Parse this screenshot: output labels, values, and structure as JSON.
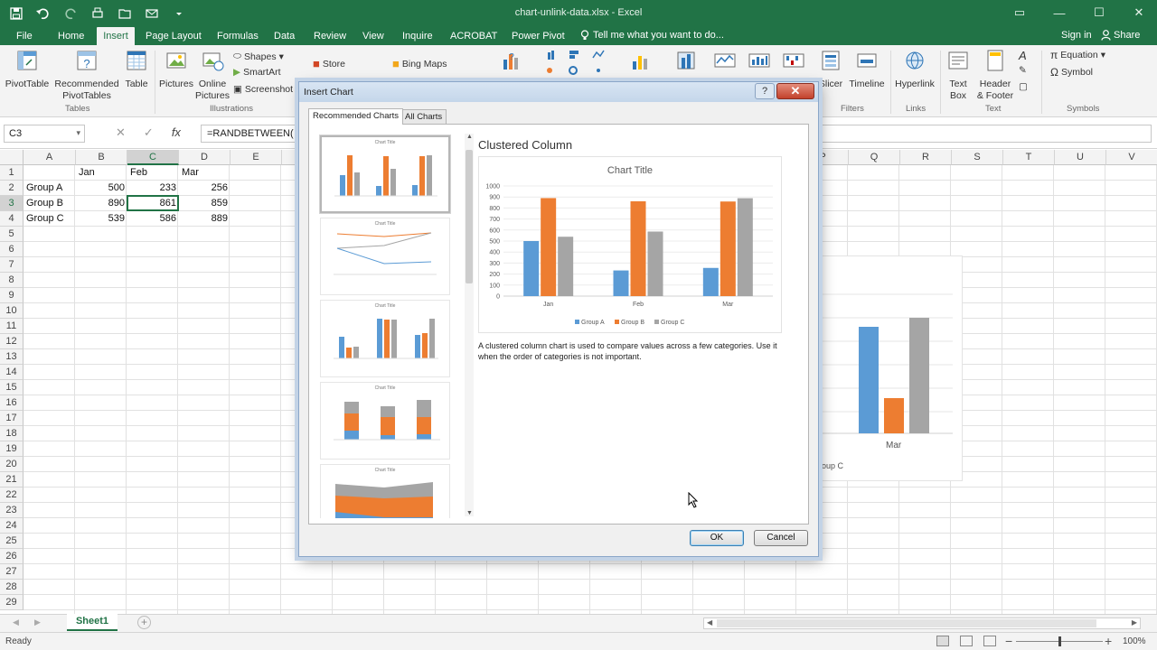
{
  "titlebar": {
    "title": "chart-unlink-data.xlsx - Excel",
    "qat_icons": [
      "save-icon",
      "undo-icon",
      "redo-icon",
      "quick-print-icon",
      "open-icon",
      "email-icon",
      "customize-icon"
    ]
  },
  "tabs": [
    {
      "label": "File",
      "active": false
    },
    {
      "label": "Home",
      "active": false
    },
    {
      "label": "Insert",
      "active": true
    },
    {
      "label": "Page Layout",
      "active": false
    },
    {
      "label": "Formulas",
      "active": false
    },
    {
      "label": "Data",
      "active": false
    },
    {
      "label": "Review",
      "active": false
    },
    {
      "label": "View",
      "active": false
    },
    {
      "label": "Inquire",
      "active": false
    },
    {
      "label": "ACROBAT",
      "active": false
    },
    {
      "label": "Power Pivot",
      "active": false
    }
  ],
  "tellme": "Tell me what you want to do...",
  "signin": "Sign in",
  "share": "Share",
  "ribbon": {
    "pivottable": "PivotTable",
    "recommended1": "Recommended",
    "recommended2": "PivotTables",
    "table": "Table",
    "pictures": "Pictures",
    "online1": "Online",
    "online2": "Pictures",
    "shapes": "Shapes",
    "smartart": "SmartArt",
    "screenshot": "Screenshot",
    "store": "Store",
    "bingmaps": "Bing Maps",
    "slicer": "Slicer",
    "timeline": "Timeline",
    "hyperlink": "Hyperlink",
    "textbox1": "Text",
    "textbox2": "Box",
    "header1": "Header",
    "header2": "& Footer",
    "equation": "Equation",
    "symbol": "Symbol",
    "groups": {
      "tables": "Tables",
      "illustrations": "Illustrations",
      "filters": "Filters",
      "links": "Links",
      "text": "Text",
      "symbols": "Symbols"
    }
  },
  "formulabar": {
    "namebox": "C3",
    "formula": "=RANDBETWEEN("
  },
  "grid": {
    "columns": [
      "A",
      "B",
      "C",
      "D",
      "E",
      "F",
      "G",
      "H",
      "I",
      "J",
      "K",
      "L",
      "M",
      "N",
      "O",
      "P",
      "Q",
      "R",
      "S",
      "T",
      "U",
      "V"
    ],
    "rows": [
      "1",
      "2",
      "3",
      "4",
      "5",
      "6",
      "7",
      "8",
      "9",
      "10",
      "11",
      "12",
      "13",
      "14",
      "15",
      "16",
      "17",
      "18",
      "19",
      "20",
      "21",
      "22",
      "23",
      "24",
      "25",
      "26",
      "27",
      "28",
      "29"
    ],
    "header_row": [
      "",
      "Jan",
      "Feb",
      "Mar"
    ],
    "data_rows": [
      [
        "Group A",
        "500",
        "233",
        "256"
      ],
      [
        "Group B",
        "890",
        "861",
        "859"
      ],
      [
        "Group C",
        "539",
        "586",
        "889"
      ]
    ],
    "selected_column": "C",
    "selected_row": "3"
  },
  "background_chart": {
    "x_label": "Mar",
    "legend_fragment": "oup C"
  },
  "sheet": {
    "tab": "Sheet1",
    "status": "Ready",
    "zoom": "100%"
  },
  "dialog": {
    "title": "Insert Chart",
    "help": "?",
    "close": "✕",
    "tab_recommended": "Recommended Charts",
    "tab_all": "All Charts",
    "preview_title": "Clustered Column",
    "description": "A clustered column chart is used to compare values across a few categories. Use it when the order of categories is not important.",
    "ok": "OK",
    "cancel": "Cancel",
    "thumbnail_title": "Chart Title"
  },
  "colors": {
    "excel_green": "#217346",
    "group_a": "#5b9bd5",
    "group_b": "#ed7d31",
    "group_c": "#a5a5a5"
  },
  "chart_data": {
    "type": "bar",
    "title": "Chart Title",
    "categories": [
      "Jan",
      "Feb",
      "Mar"
    ],
    "series": [
      {
        "name": "Group A",
        "values": [
          500,
          233,
          256
        ]
      },
      {
        "name": "Group B",
        "values": [
          890,
          861,
          859
        ]
      },
      {
        "name": "Group C",
        "values": [
          539,
          586,
          889
        ]
      }
    ],
    "ylim": [
      0,
      1000
    ],
    "yticks": [
      0,
      100,
      200,
      300,
      400,
      500,
      600,
      700,
      800,
      900,
      1000
    ],
    "grid": true,
    "legend": "bottom"
  }
}
